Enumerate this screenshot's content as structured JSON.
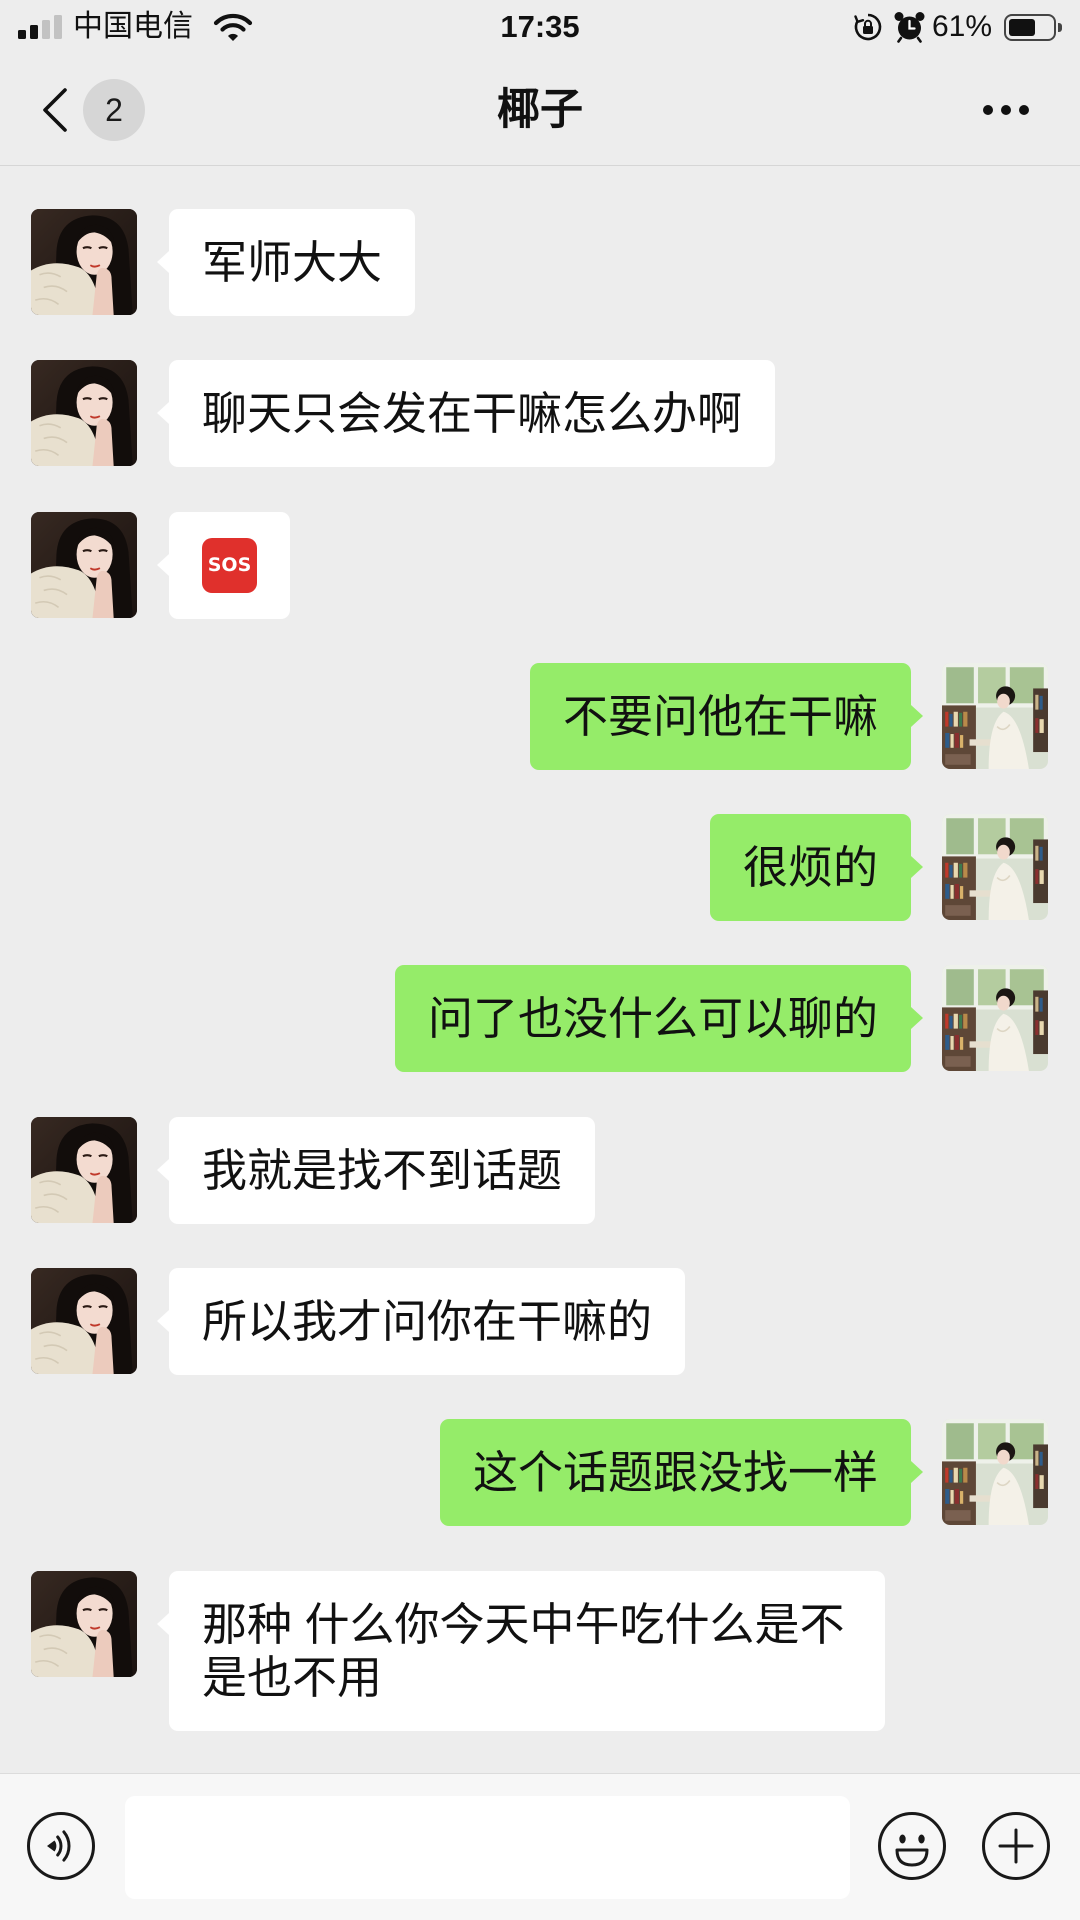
{
  "status_bar": {
    "carrier": "中国电信",
    "time": "17:35",
    "battery_percent": "61%",
    "battery_level": 61,
    "signal_bars": 2,
    "icons": [
      "signal-icon",
      "wifi-icon",
      "rotation-lock-icon",
      "alarm-icon",
      "battery-icon"
    ]
  },
  "header": {
    "back_icon": "chevron-left-icon",
    "unread_count": "2",
    "title": "椰子",
    "more_icon": "more-icon"
  },
  "messages": [
    {
      "avatar": "contact-avatar",
      "text": "军师大大"
    },
    {
      "avatar": "contact-avatar",
      "text": "聊天只会发在干嘛怎么办啊"
    },
    {
      "avatar": "contact-avatar",
      "icon": "sos-icon",
      "label": "SOS"
    },
    {
      "avatar": "my-avatar",
      "text": "不要问他在干嘛"
    },
    {
      "avatar": "my-avatar",
      "text": "很烦的"
    },
    {
      "avatar": "my-avatar",
      "text": "问了也没什么可以聊的"
    },
    {
      "avatar": "contact-avatar",
      "text": "我就是找不到话题"
    },
    {
      "avatar": "contact-avatar",
      "text": "所以我才问你在干嘛的"
    },
    {
      "avatar": "my-avatar",
      "text": "这个话题跟没找一样"
    },
    {
      "avatar": "contact-avatar",
      "text": "那种 什么你今天中午吃什么是不是也不用"
    }
  ],
  "input_bar": {
    "voice_icon": "voice-icon",
    "value": "",
    "emoji_icon": "emoji-icon",
    "plus_icon": "plus-icon"
  },
  "colors": {
    "background": "#ededed",
    "bubble_incoming": "#ffffff",
    "bubble_outgoing": "#95ec69",
    "sticker_red": "#e0302c"
  }
}
